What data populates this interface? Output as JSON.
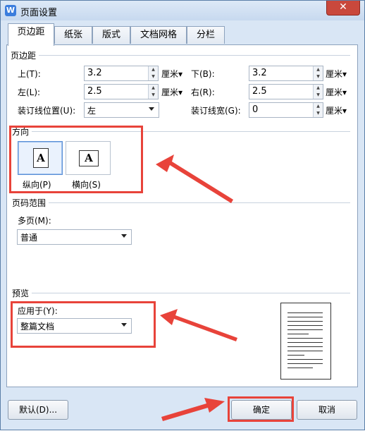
{
  "window": {
    "title": "页面设置",
    "app_icon": "W",
    "close_glyph": "✕",
    "accent": "#e8433a"
  },
  "tabs": [
    "页边距",
    "纸张",
    "版式",
    "文档网格",
    "分栏"
  ],
  "margins": {
    "section_title": "页边距",
    "top": {
      "label": "上(T):",
      "value": "3.2",
      "unit": "厘米"
    },
    "bottom": {
      "label": "下(B):",
      "value": "3.2",
      "unit": "厘米"
    },
    "left": {
      "label": "左(L):",
      "value": "2.5",
      "unit": "厘米"
    },
    "right": {
      "label": "右(R):",
      "value": "2.5",
      "unit": "厘米"
    },
    "gutter_pos": {
      "label": "装订线位置(U):",
      "value": "左"
    },
    "gutter_width": {
      "label": "装订线宽(G):",
      "value": "0",
      "unit": "厘米"
    }
  },
  "orientation": {
    "section_title": "方向",
    "portrait": {
      "label": "纵向(P)",
      "glyph": "A",
      "selected": true
    },
    "landscape": {
      "label": "横向(S)",
      "glyph": "A",
      "selected": false
    }
  },
  "pages": {
    "section_title": "页码范围",
    "label": "多页(M):",
    "value": "普通"
  },
  "preview": {
    "section_title": "预览",
    "apply_label": "应用于(Y):",
    "apply_value": "整篇文档"
  },
  "buttons": {
    "default": "默认(D)...",
    "ok": "确定",
    "cancel": "取消"
  }
}
